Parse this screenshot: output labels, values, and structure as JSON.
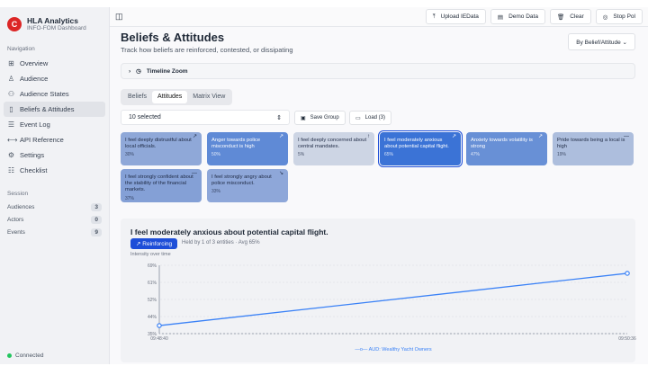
{
  "brand": {
    "title": "HLA Analytics",
    "subtitle": "INFO-FOM Dashboard"
  },
  "nav": {
    "section": "Navigation",
    "items": [
      {
        "label": "Overview",
        "icon": "grid-icon"
      },
      {
        "label": "Audience",
        "icon": "user-icon"
      },
      {
        "label": "Audience States",
        "icon": "users-icon"
      },
      {
        "label": "Beliefs & Attitudes",
        "icon": "book-icon",
        "active": true
      },
      {
        "label": "Event Log",
        "icon": "log-icon"
      },
      {
        "label": "API Reference",
        "icon": "api-icon"
      },
      {
        "label": "Settings",
        "icon": "gear-icon"
      },
      {
        "label": "Checklist",
        "icon": "checklist-icon"
      }
    ]
  },
  "session": {
    "title": "Session",
    "rows": [
      {
        "label": "Audiences",
        "value": "3"
      },
      {
        "label": "Actors",
        "value": "0"
      },
      {
        "label": "Events",
        "value": "9"
      }
    ]
  },
  "status": "Connected",
  "toolbar": {
    "upload": "Upload IEData",
    "demo": "Demo Data",
    "clear": "Clear",
    "stop": "Stop Pol"
  },
  "page": {
    "title": "Beliefs & Attitudes",
    "subtitle": "Track how beliefs are reinforced, contested, or dissipating",
    "group_by": "By Belief/Attitude",
    "timeline": "Timeline Zoom"
  },
  "tabs": [
    "Beliefs",
    "Attitudes",
    "Matrix View"
  ],
  "selection": {
    "value": "10 selected",
    "save": "Save Group",
    "load": "Load (3)"
  },
  "cards": [
    {
      "text": "I feel deeply distrustful about local officials.",
      "pct": "30%",
      "trend": "↗",
      "bg": "#8fa8d8",
      "fg": "#1f2a44"
    },
    {
      "text": "Anger towards police misconduct is high",
      "pct": "50%",
      "trend": "↗",
      "bg": "#5f8ad6",
      "fg": "#ffffff"
    },
    {
      "text": "I feel deeply concerned about central mandates.",
      "pct": "5%",
      "trend": "↑",
      "bg": "#cdd5e4",
      "fg": "#1f2a44"
    },
    {
      "text": "I feel moderately anxious about potential capital flight.",
      "pct": "65%",
      "trend": "↗",
      "bg": "#3b73d6",
      "fg": "#ffffff",
      "selected": true
    },
    {
      "text": "Anxiety towards volatility is strong",
      "pct": "47%",
      "trend": "↗",
      "bg": "#6890d6",
      "fg": "#ffffff"
    },
    {
      "text": "Pride towards being a local is high",
      "pct": "19%",
      "trend": "—",
      "bg": "#adbedd",
      "fg": "#1f2a44"
    },
    {
      "text": "I feel strongly confident about the stability of the financial markets.",
      "pct": "37%",
      "trend": "—",
      "bg": "#84a0d6",
      "fg": "#1f2a44"
    },
    {
      "text": "I feel strongly angry about police misconduct.",
      "pct": "33%",
      "trend": "↘",
      "bg": "#8ea7d9",
      "fg": "#1f2a44"
    }
  ],
  "detail": {
    "title": "I feel moderately anxious about potential capital flight.",
    "badge": "Reinforcing",
    "held": "Held by 1 of 3 entities · Avg 65%",
    "chart_label": "Intensity over time"
  },
  "chart_data": {
    "type": "line",
    "ylabel": "Intensity over time",
    "yticks": [
      "35%",
      "44%",
      "52%",
      "61%",
      "69%"
    ],
    "ylim": [
      35,
      69
    ],
    "x": [
      "09:48:40",
      "09:50:36"
    ],
    "series": [
      {
        "name": "AUD: Wealthy Yacht Owners",
        "values": [
          39,
          65
        ],
        "color": "#3b82f6"
      }
    ],
    "legend": "bottom"
  }
}
